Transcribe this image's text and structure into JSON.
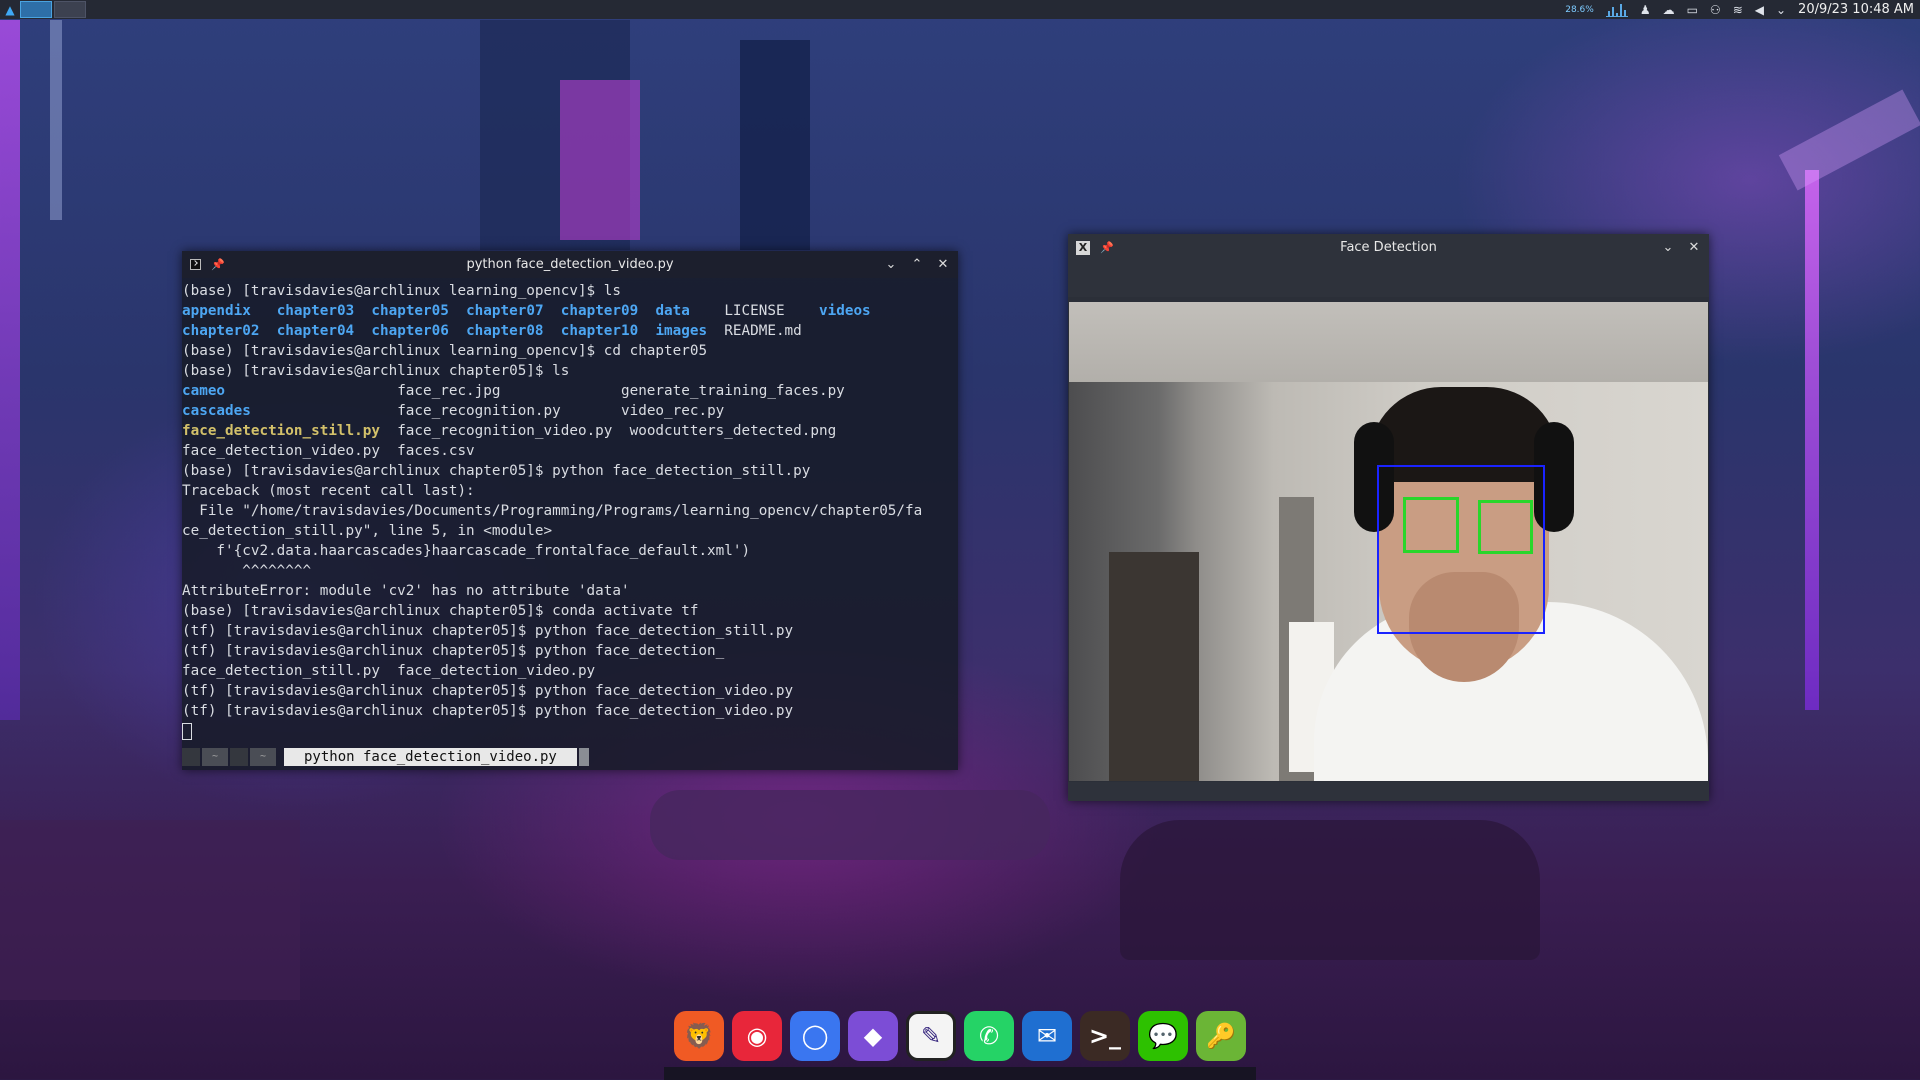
{
  "topbar": {
    "cpu_label": "28.6%",
    "clock": "20/9/23 10:48 AM",
    "tray_icons": [
      "cpu-graph-icon",
      "user-icon",
      "cloud-icon",
      "battery-icon",
      "usb-icon",
      "wifi-icon",
      "volume-icon",
      "tray-expand-icon"
    ]
  },
  "terminal": {
    "title": "python face_detection_video.py",
    "lines": [
      [
        {
          "t": "(base) [travisdavies@archlinux learning_opencv]$ ls"
        }
      ],
      [
        {
          "t": "appendix",
          "c": "dir"
        },
        {
          "t": "   "
        },
        {
          "t": "chapter03",
          "c": "dir"
        },
        {
          "t": "  "
        },
        {
          "t": "chapter05",
          "c": "dir"
        },
        {
          "t": "  "
        },
        {
          "t": "chapter07",
          "c": "dir"
        },
        {
          "t": "  "
        },
        {
          "t": "chapter09",
          "c": "dir"
        },
        {
          "t": "  "
        },
        {
          "t": "data",
          "c": "dir"
        },
        {
          "t": "    LICENSE    "
        },
        {
          "t": "videos",
          "c": "dir"
        }
      ],
      [
        {
          "t": "chapter02",
          "c": "dir"
        },
        {
          "t": "  "
        },
        {
          "t": "chapter04",
          "c": "dir"
        },
        {
          "t": "  "
        },
        {
          "t": "chapter06",
          "c": "dir"
        },
        {
          "t": "  "
        },
        {
          "t": "chapter08",
          "c": "dir"
        },
        {
          "t": "  "
        },
        {
          "t": "chapter10",
          "c": "dir"
        },
        {
          "t": "  "
        },
        {
          "t": "images",
          "c": "dir"
        },
        {
          "t": "  README.md"
        }
      ],
      [
        {
          "t": "(base) [travisdavies@archlinux learning_opencv]$ cd chapter05"
        }
      ],
      [
        {
          "t": "(base) [travisdavies@archlinux chapter05]$ ls"
        }
      ],
      [
        {
          "t": "cameo",
          "c": "dir"
        },
        {
          "t": "                    face_rec.jpg              generate_training_faces.py"
        }
      ],
      [
        {
          "t": "cascades",
          "c": "dir"
        },
        {
          "t": "                 face_recognition.py       video_rec.py"
        }
      ],
      [
        {
          "t": "face_detection_still.py",
          "c": "hl"
        },
        {
          "t": "  face_recognition_video.py  woodcutters_detected.png"
        }
      ],
      [
        {
          "t": "face_detection_video.py  faces.csv"
        }
      ],
      [
        {
          "t": "(base) [travisdavies@archlinux chapter05]$ python face_detection_still.py"
        }
      ],
      [
        {
          "t": "Traceback (most recent call last):"
        }
      ],
      [
        {
          "t": "  File \"/home/travisdavies/Documents/Programming/Programs/learning_opencv/chapter05/fa"
        }
      ],
      [
        {
          "t": "ce_detection_still.py\", line 5, in <module>"
        }
      ],
      [
        {
          "t": "    f'{cv2.data.haarcascades}haarcascade_frontalface_default.xml')"
        }
      ],
      [
        {
          "t": "       ^^^^^^^^"
        }
      ],
      [
        {
          "t": "AttributeError: module 'cv2' has no attribute 'data'"
        }
      ],
      [
        {
          "t": "(base) [travisdavies@archlinux chapter05]$ conda activate tf"
        }
      ],
      [
        {
          "t": "(tf) [travisdavies@archlinux chapter05]$ python face_detection_still.py"
        }
      ],
      [
        {
          "t": "(tf) [travisdavies@archlinux chapter05]$ python face_detection_"
        }
      ],
      [
        {
          "t": "face_detection_still.py  face_detection_video.py"
        }
      ],
      [
        {
          "t": "(tf) [travisdavies@archlinux chapter05]$ python face_detection_video.py"
        }
      ],
      [
        {
          "t": "(tf) [travisdavies@archlinux chapter05]$ python face_detection_video.py"
        }
      ]
    ],
    "status": {
      "tab1": "~",
      "tab2": "~",
      "active_command": "python face_detection_video.py"
    }
  },
  "face_window": {
    "title": "Face Detection",
    "box_colors": {
      "face": "#1a23ff",
      "eyes": "#29d62b"
    }
  },
  "dock": {
    "apps": [
      {
        "name": "brave-browser-icon",
        "glyph": "🦁",
        "color": "#f05a24"
      },
      {
        "name": "media-recorder-icon",
        "glyph": "◉",
        "color": "#e8263a"
      },
      {
        "name": "signal-icon",
        "glyph": "◯",
        "color": "#3a76f0"
      },
      {
        "name": "obsidian-icon",
        "glyph": "◆",
        "color": "#7c4dd6"
      },
      {
        "name": "text-editor-icon",
        "glyph": "✎",
        "color": "#f4f4f4"
      },
      {
        "name": "whatsapp-icon",
        "glyph": "✆",
        "color": "#25d366"
      },
      {
        "name": "mail-icon",
        "glyph": "✉",
        "color": "#1f6fd1"
      },
      {
        "name": "terminal-app-icon",
        "glyph": ">_",
        "color": "#3b2a24"
      },
      {
        "name": "wechat-icon",
        "glyph": "💬",
        "color": "#2dc100"
      },
      {
        "name": "keepassxc-icon",
        "glyph": "🔑",
        "color": "#6bb536"
      }
    ]
  }
}
